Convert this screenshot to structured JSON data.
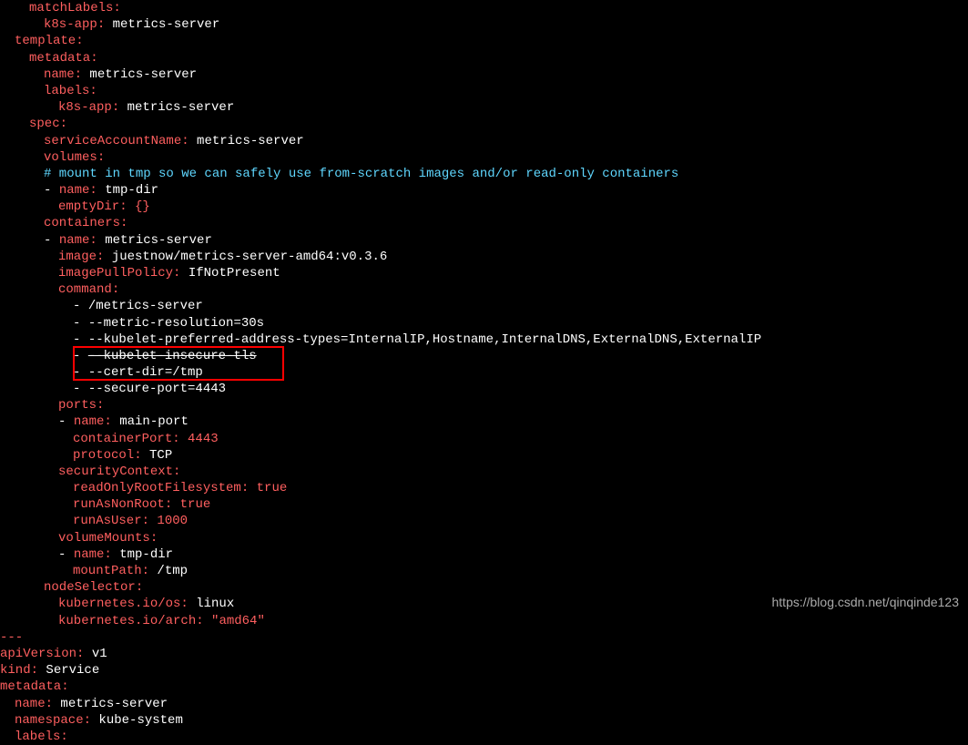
{
  "lines": {
    "l1": {
      "key": "matchLabels",
      "colon": ":"
    },
    "l2": {
      "key": "k8s-app",
      "colon": ":",
      "val": " metrics-server"
    },
    "l3": {
      "key": "template",
      "colon": ":"
    },
    "l4": {
      "key": "metadata",
      "colon": ":"
    },
    "l5": {
      "key": "name",
      "colon": ":",
      "val": " metrics-server"
    },
    "l6": {
      "key": "labels",
      "colon": ":"
    },
    "l7": {
      "key": "k8s-app",
      "colon": ":",
      "val": " metrics-server"
    },
    "l8": {
      "key": "spec",
      "colon": ":"
    },
    "l9": {
      "key": "serviceAccountName",
      "colon": ":",
      "val": " metrics-server"
    },
    "l10": {
      "key": "volumes",
      "colon": ":"
    },
    "l11": {
      "comment": "# mount in tmp so we can safely use from-scratch images and/or read-only containers"
    },
    "l12": {
      "dash": "- ",
      "key": "name",
      "colon": ":",
      "val": " tmp-dir"
    },
    "l13": {
      "key": "emptyDir",
      "colon": ":",
      "val": " {}"
    },
    "l14": {
      "key": "containers",
      "colon": ":"
    },
    "l15": {
      "dash": "- ",
      "key": "name",
      "colon": ":",
      "val": " metrics-server"
    },
    "l16": {
      "key": "image",
      "colon": ":",
      "val": " juestnow/metrics-server-amd64:v0.3.6"
    },
    "l17": {
      "key": "imagePullPolicy",
      "colon": ":",
      "val": " IfNotPresent"
    },
    "l18": {
      "key": "command",
      "colon": ":"
    },
    "l19": {
      "dash": "- ",
      "val": "/metrics-server"
    },
    "l20": {
      "dash": "- ",
      "val": "--metric-resolution=30s"
    },
    "l21": {
      "dash": "- ",
      "val": "--kubelet-preferred-address-types=InternalIP,Hostname,InternalDNS,ExternalDNS,ExternalIP"
    },
    "l22a": {
      "dash": "- ",
      "val": "--kubelet-insecure-tls"
    },
    "l22b": {
      "dash": "- ",
      "val": "--cert-dir=/tmp"
    },
    "l23": {
      "dash": "- ",
      "val": "--secure-port=4443"
    },
    "l24": {
      "key": "ports",
      "colon": ":"
    },
    "l25": {
      "dash": "- ",
      "key": "name",
      "colon": ":",
      "val": " main-port"
    },
    "l26": {
      "key": "containerPort",
      "colon": ":",
      "val": " 4443"
    },
    "l27": {
      "key": "protocol",
      "colon": ":",
      "val": " TCP"
    },
    "l28": {
      "key": "securityContext",
      "colon": ":"
    },
    "l29": {
      "key": "readOnlyRootFilesystem",
      "colon": ":",
      "val": " true"
    },
    "l30": {
      "key": "runAsNonRoot",
      "colon": ":",
      "val": " true"
    },
    "l31": {
      "key": "runAsUser",
      "colon": ":",
      "val": " 1000"
    },
    "l32": {
      "key": "volumeMounts",
      "colon": ":"
    },
    "l33": {
      "dash": "- ",
      "key": "name",
      "colon": ":",
      "val": " tmp-dir"
    },
    "l34": {
      "key": "mountPath",
      "colon": ":",
      "val": " /tmp"
    },
    "l35": {
      "key": "nodeSelector",
      "colon": ":"
    },
    "l36": {
      "key": "kubernetes.io/os",
      "colon": ":",
      "val": " linux"
    },
    "l37": {
      "key": "kubernetes.io/arch",
      "colon": ":",
      "val": " \"amd64\""
    },
    "l38": {
      "dash": "---"
    },
    "l39": {
      "key": "apiVersion",
      "colon": ":",
      "val": " v1"
    },
    "l40": {
      "key": "kind",
      "colon": ":",
      "val": " Service"
    },
    "l41": {
      "key": "metadata",
      "colon": ":"
    },
    "l42": {
      "key": "name",
      "colon": ":",
      "val": " metrics-server"
    },
    "l43": {
      "key": "namespace",
      "colon": ":",
      "val": " kube-system"
    },
    "l44": {
      "key": "labels",
      "colon": ":"
    }
  },
  "watermark": "https://blog.csdn.net/qinqinde123"
}
